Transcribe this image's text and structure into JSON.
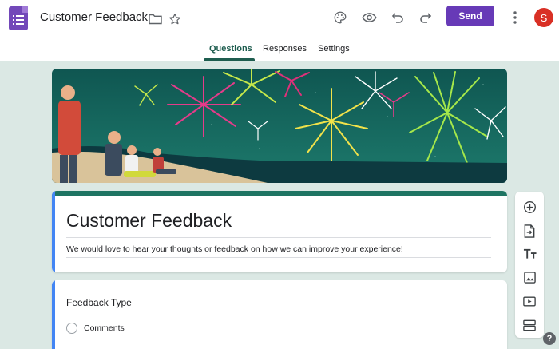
{
  "header": {
    "title": "Customer Feedback",
    "send_label": "Send",
    "avatar_initial": "S",
    "icons": [
      "forms-logo-icon",
      "folder-icon",
      "star-icon",
      "palette-icon",
      "eye-icon",
      "undo-icon",
      "redo-icon",
      "more-vert-icon"
    ]
  },
  "tabs": [
    {
      "label": "Questions",
      "active": true
    },
    {
      "label": "Responses",
      "active": false
    },
    {
      "label": "Settings",
      "active": false
    }
  ],
  "form": {
    "title": "Customer Feedback",
    "description": "We would love to hear your thoughts or feedback on how we can improve your experience!"
  },
  "question": {
    "title": "Feedback Type",
    "options": [
      "Comments"
    ]
  },
  "side_toolbar": [
    "add-question-icon",
    "import-questions-icon",
    "add-title-icon",
    "add-image-icon",
    "add-video-icon",
    "add-section-icon"
  ],
  "help_label": "?",
  "colors": {
    "accent": "#673ab7",
    "theme": "#1e7462",
    "background": "#dbe8e4",
    "active_bar": "#4285f4"
  }
}
